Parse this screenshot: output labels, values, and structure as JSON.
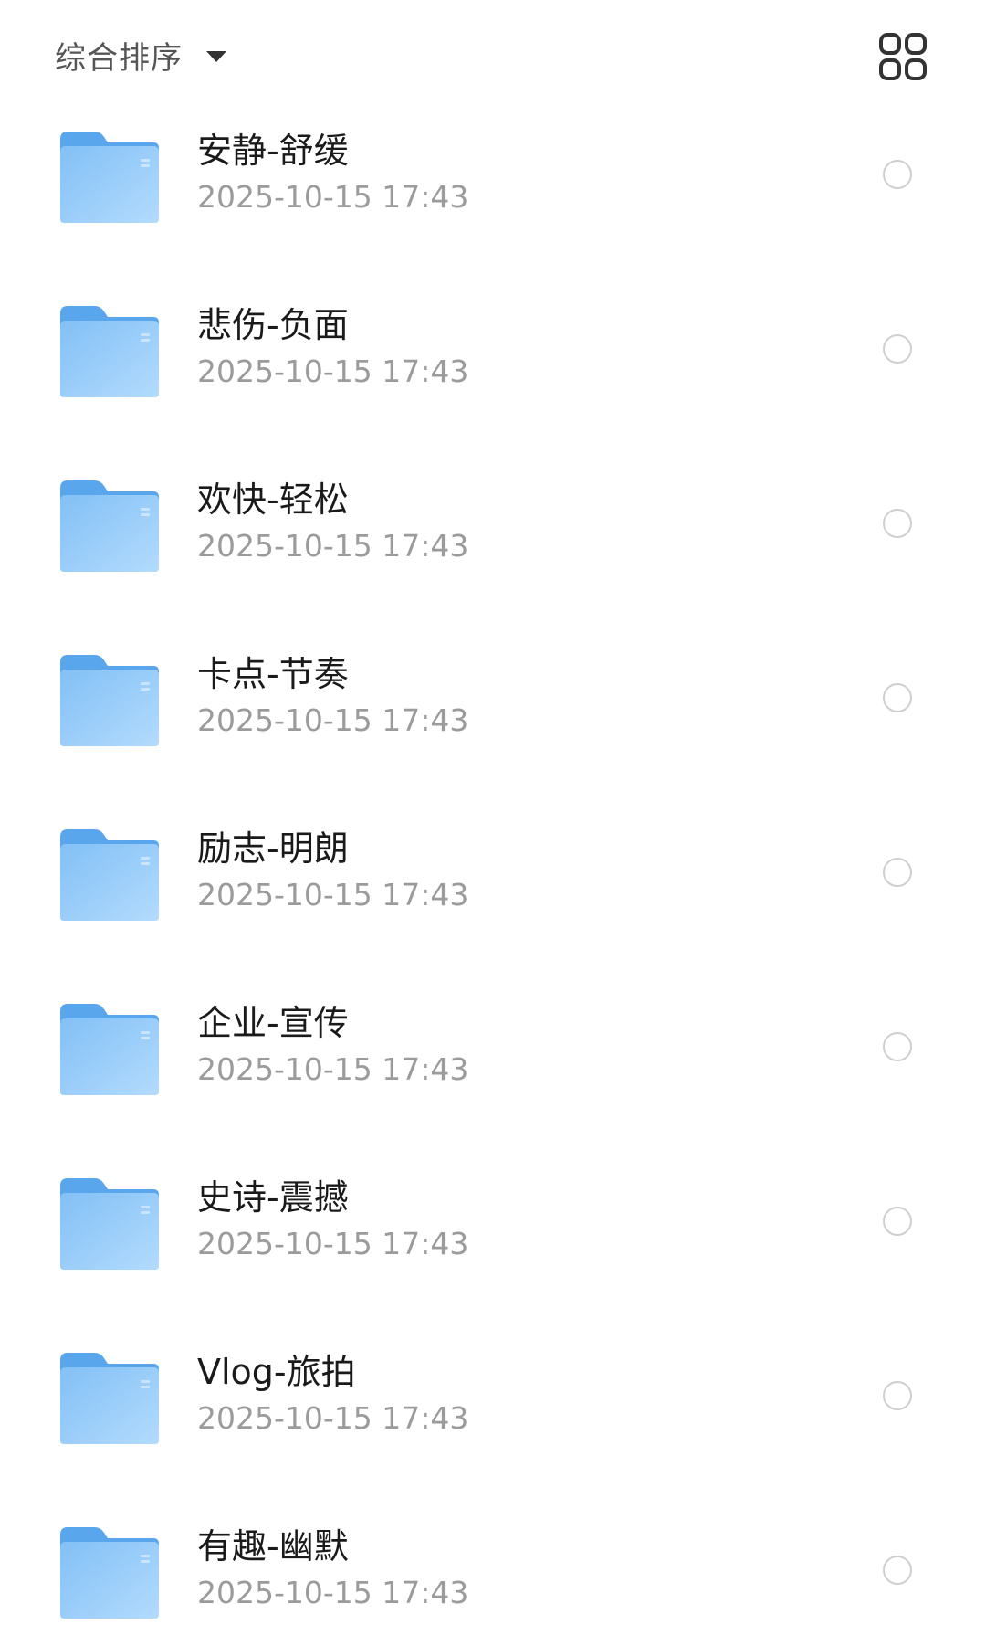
{
  "toolbar": {
    "sort_label": "综合排序",
    "sort_icon": "caret-down-icon",
    "view_toggle_icon": "grid-view-icon"
  },
  "colors": {
    "folder_light": "#a6d3fb",
    "folder_main": "#7bbcf5",
    "folder_tab": "#5aa6ec",
    "radio_border": "#cfcfcf",
    "title_text": "#1a1a1a",
    "meta_text": "#9b9b9b"
  },
  "folders": [
    {
      "name": "安静-舒缓",
      "time": "2025-10-15 17:43"
    },
    {
      "name": "悲伤-负面",
      "time": "2025-10-15 17:43"
    },
    {
      "name": "欢快-轻松",
      "time": "2025-10-15 17:43"
    },
    {
      "name": "卡点-节奏",
      "time": "2025-10-15 17:43"
    },
    {
      "name": "励志-明朗",
      "time": "2025-10-15 17:43"
    },
    {
      "name": "企业-宣传",
      "time": "2025-10-15 17:43"
    },
    {
      "name": "史诗-震撼",
      "time": "2025-10-15 17:43"
    },
    {
      "name": "Vlog-旅拍",
      "time": "2025-10-15 17:43"
    },
    {
      "name": "有趣-幽默",
      "time": "2025-10-15 17:43"
    }
  ]
}
